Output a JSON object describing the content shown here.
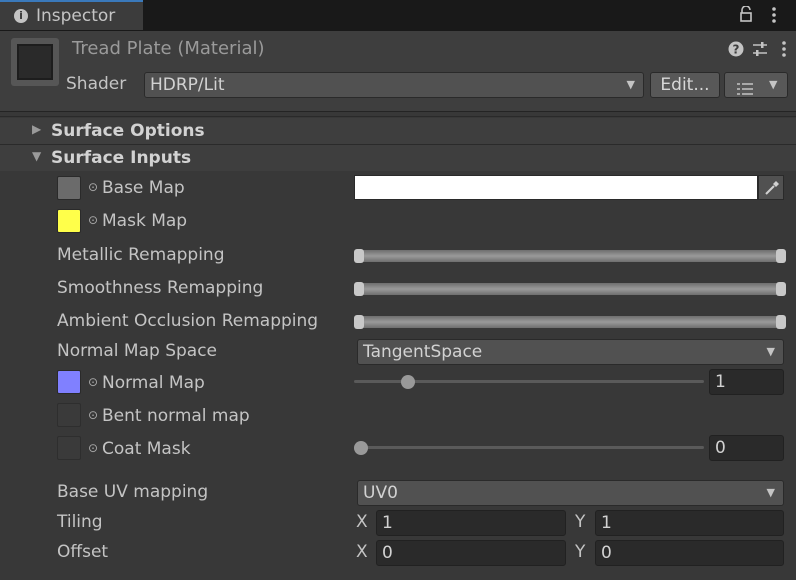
{
  "tab": {
    "title": "Inspector",
    "icon": "info-icon"
  },
  "header": {
    "material_name": "Tread Plate (Material)",
    "shader_label": "Shader",
    "shader_value": "HDRP/Lit",
    "edit_label": "Edit...",
    "icons": [
      "help-icon",
      "settings-sliders-icon",
      "kebab-menu-icon",
      "lock-icon",
      "list-icon"
    ]
  },
  "sections": {
    "surface_options": "Surface Options",
    "surface_inputs": "Surface Inputs"
  },
  "properties": {
    "base_map": "Base Map",
    "mask_map": "Mask Map",
    "metallic_remap": "Metallic Remapping",
    "smoothness_remap": "Smoothness Remapping",
    "ao_remap": "Ambient Occlusion Remapping",
    "normal_space_label": "Normal Map Space",
    "normal_space_value": "TangentSpace",
    "normal_map": "Normal Map",
    "normal_scale": "1",
    "normal_slider_fraction": 0.14,
    "bent_normal": "Bent normal map",
    "coat_mask": "Coat Mask",
    "coat_value": "0",
    "coat_slider_fraction": 0.0,
    "uv_label": "Base UV mapping",
    "uv_value": "UV0",
    "tiling_label": "Tiling",
    "tiling_x": "1",
    "tiling_y": "1",
    "offset_label": "Offset",
    "offset_x": "0",
    "offset_y": "0",
    "x_axis": "X",
    "y_axis": "Y"
  },
  "colors": {
    "base_map_swatch": "#6b6b6b",
    "mask_map_swatch": "#ffff4a",
    "normal_map_swatch": "#8080ff",
    "base_color": "#ffffff",
    "accent": "#3a79bb"
  }
}
